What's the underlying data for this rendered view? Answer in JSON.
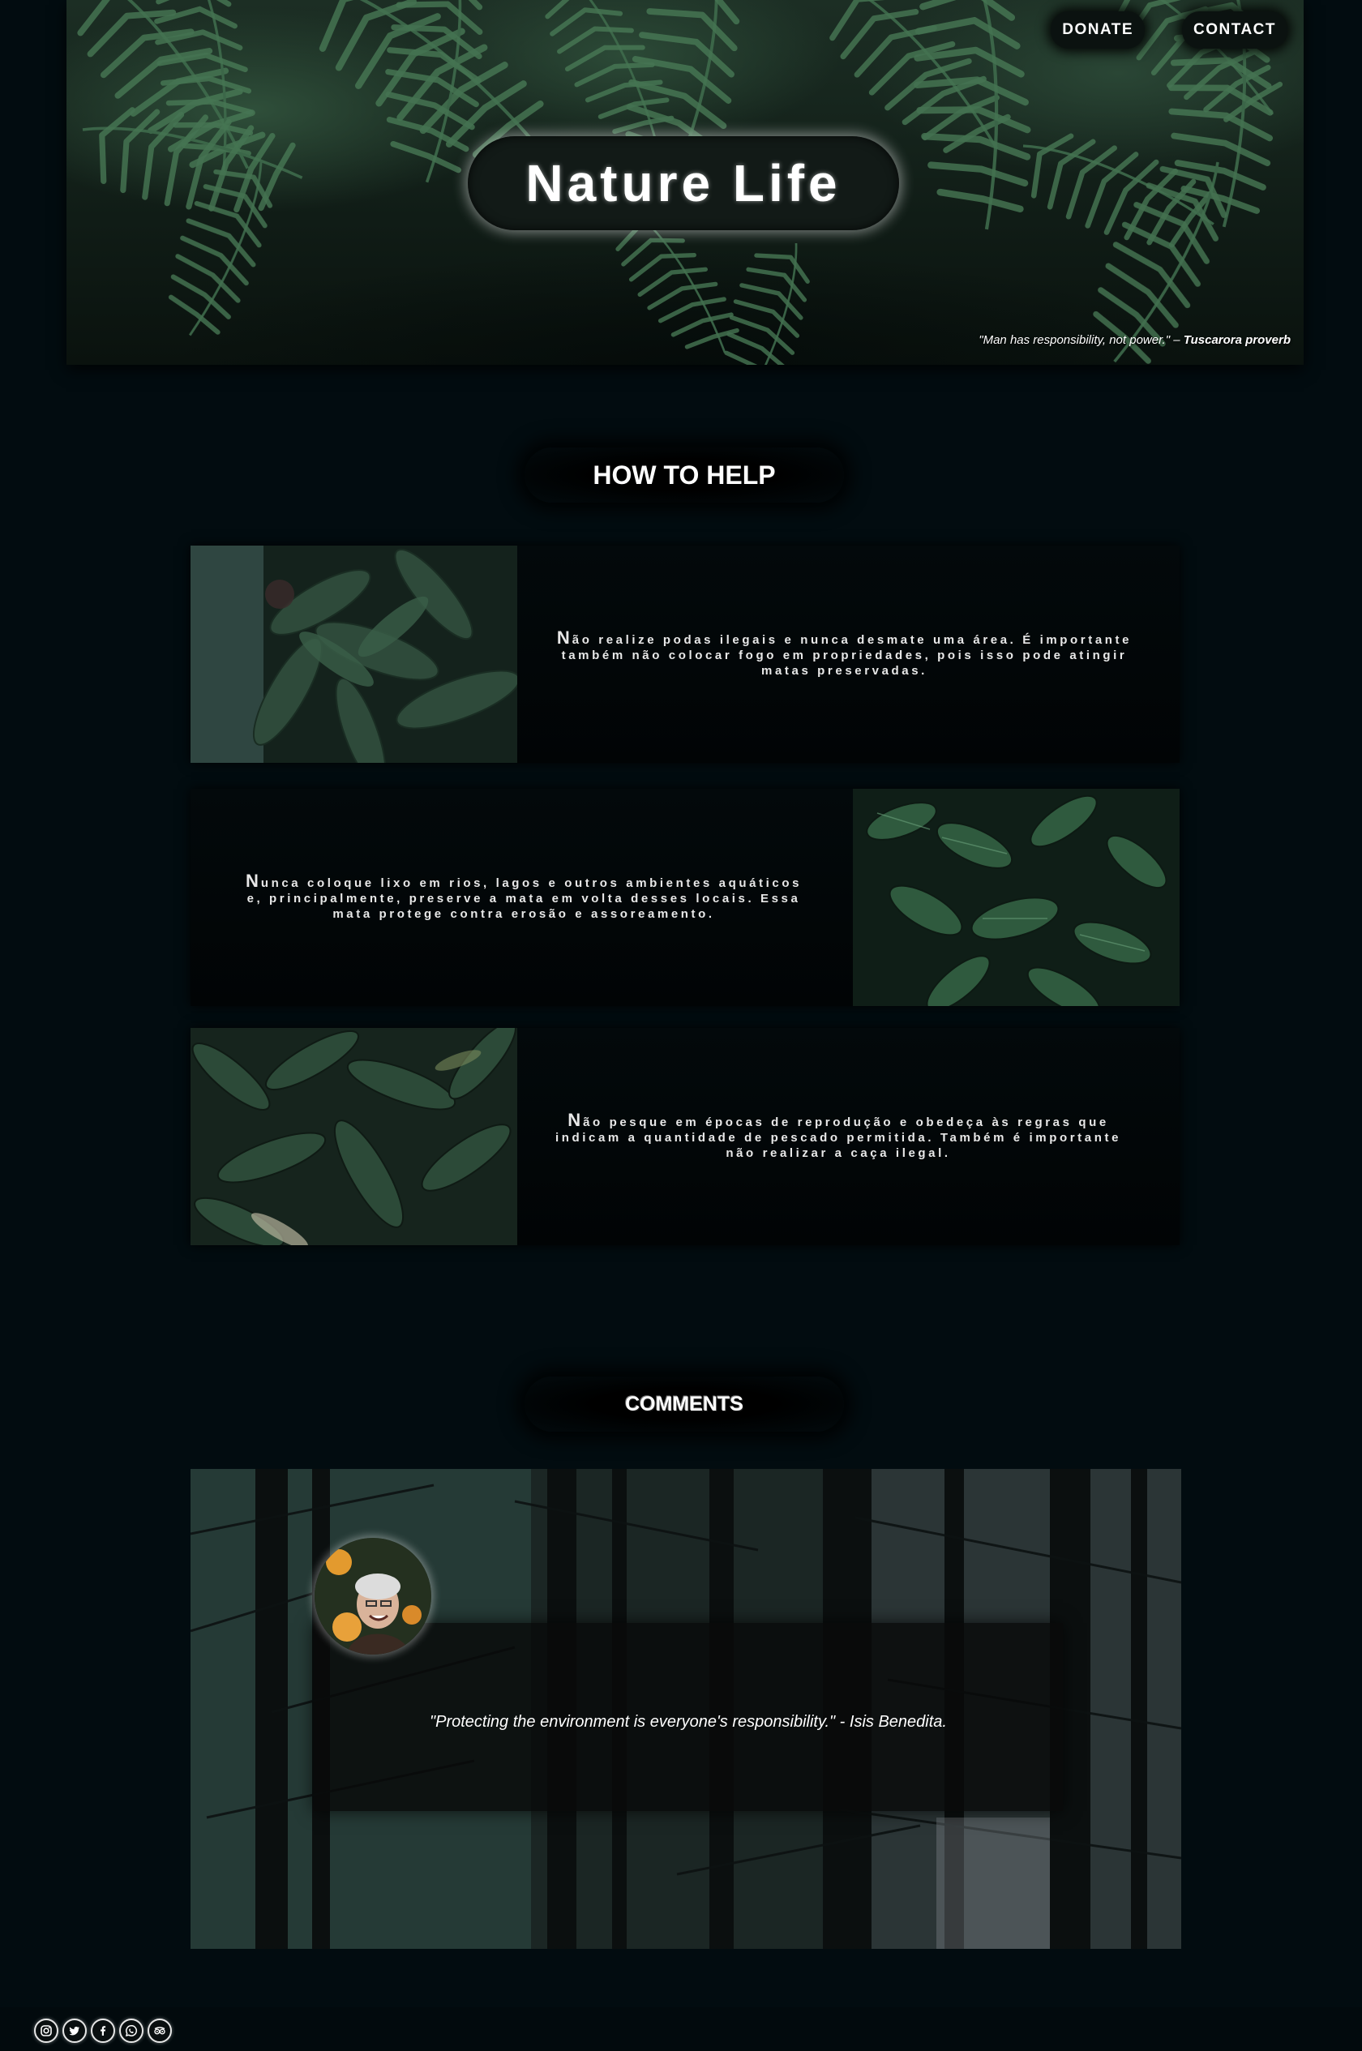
{
  "header": {
    "title": "Nature Life",
    "nav": {
      "donate": "DONATE",
      "contact": "CONTACT"
    },
    "quote": {
      "text": "\"Man has responsibility, not power.\" –",
      "author": "Tuscarora proverb"
    }
  },
  "help": {
    "title": "HOW TO HELP",
    "items": [
      {
        "initial": "N",
        "text": "ão realize podas ilegais e nunca desmate uma área. É importante também não colocar fogo em propriedades, pois isso pode atingir matas preservadas."
      },
      {
        "initial": "N",
        "text": "unca coloque lixo em rios, lagos e outros ambientes aquáticos e, principalmente, preserve a mata em volta desses locais. Essa mata protege contra erosão e assoreamento."
      },
      {
        "initial": "N",
        "text": "ão pesque em épocas de reprodução e obedeça às regras que indicam a quantidade de pescado permitida. Também é importante não realizar a caça ilegal."
      }
    ]
  },
  "comments": {
    "title": "COMMENTS",
    "items": [
      {
        "text": "\"Protecting the environment is everyone's responsibility.\" - Isis Benedita."
      }
    ]
  },
  "footer": {
    "social_icons": [
      "instagram-icon",
      "twitter-icon",
      "facebook-icon",
      "whatsapp-icon",
      "tripadvisor-icon"
    ]
  },
  "colors": {
    "background": "#020c10",
    "card": "#03090b",
    "text": "#ffffff"
  }
}
